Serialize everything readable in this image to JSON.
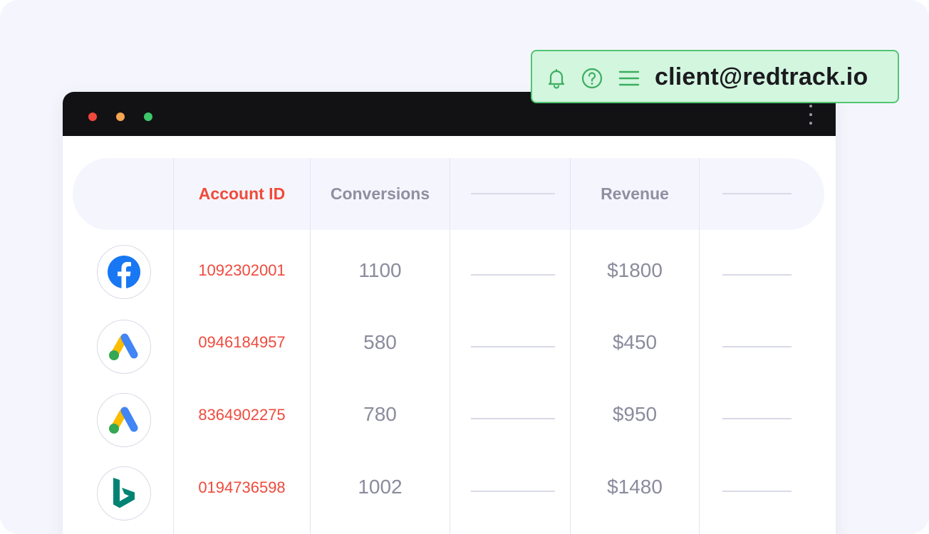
{
  "header_bar": {
    "user_email": "client@redtrack.io",
    "icons": [
      "bell-icon",
      "help-icon",
      "menu-icon"
    ]
  },
  "window": {
    "controls": [
      "close-dot",
      "minimize-dot",
      "maximize-dot"
    ],
    "menu_icon": "kebab-menu-icon"
  },
  "table": {
    "columns": [
      "",
      "Account ID",
      "Conversions",
      "",
      "Revenue",
      ""
    ],
    "active_column": "Account ID",
    "rows": [
      {
        "source_icon": "facebook-icon",
        "account_id": "1092302001",
        "conversions": "1100",
        "revenue": "$1800"
      },
      {
        "source_icon": "google-ads-icon",
        "account_id": "0946184957",
        "conversions": "580",
        "revenue": "$450"
      },
      {
        "source_icon": "google-ads-icon",
        "account_id": "8364902275",
        "conversions": "780",
        "revenue": "$950"
      },
      {
        "source_icon": "bing-icon",
        "account_id": "0194736598",
        "conversions": "1002",
        "revenue": "$1480"
      }
    ]
  },
  "colors": {
    "accent": "#f04a3a",
    "pill_bg": "#d3f6df",
    "pill_border": "#52c473",
    "titlebar": "#121214",
    "facebook": "#1877f2",
    "bing": "#008373"
  }
}
